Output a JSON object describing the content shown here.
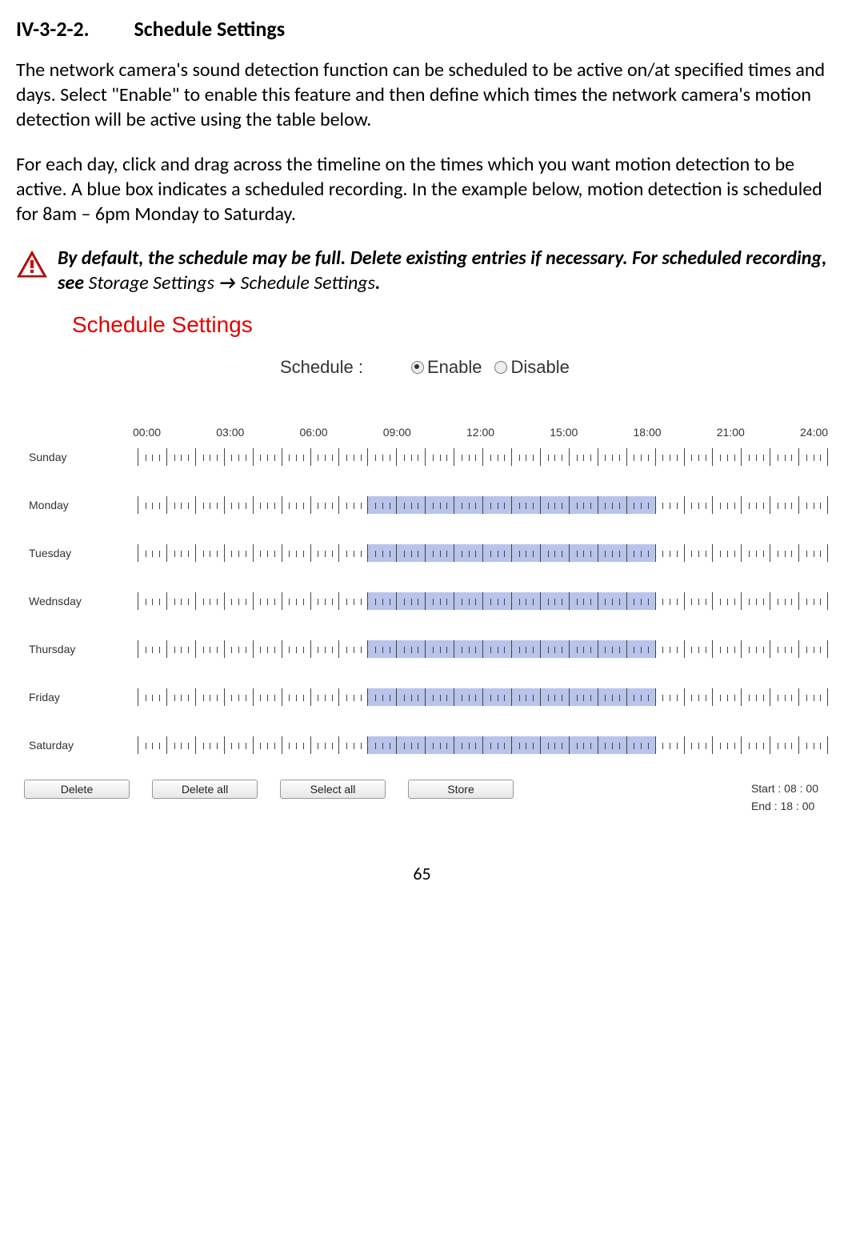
{
  "heading": {
    "number": "IV-3-2-2.",
    "title": "Schedule Settings"
  },
  "para1": "The network camera's sound detection function can be scheduled to be active on/at specified times and days. Select \"Enable\" to enable this feature and then define which times the network camera's motion detection will be active using the table below.",
  "para2": "For each day, click and drag across the timeline on the times which you want motion detection to be active. A blue box indicates a scheduled recording. In the example below, motion detection is scheduled for 8am – 6pm Monday to Saturday.",
  "note": {
    "bold1": "By default, the schedule may be full. Delete existing entries if necessary. For scheduled recording, see ",
    "plain1": "Storage Settings ",
    "arrow": "→ ",
    "plain2": "Schedule Settings",
    "bold2": "."
  },
  "panel": {
    "title": "Schedule Settings",
    "schedule_label": "Schedule :",
    "enable": "Enable",
    "disable": "Disable"
  },
  "time_labels": [
    "00:00",
    "03:00",
    "06:00",
    "09:00",
    "12:00",
    "15:00",
    "18:00",
    "21:00",
    "24:00"
  ],
  "days": [
    {
      "label": "Sunday",
      "sel": null
    },
    {
      "label": "Monday",
      "sel": [
        33.33,
        75
      ]
    },
    {
      "label": "Tuesday",
      "sel": [
        33.33,
        75
      ]
    },
    {
      "label": "Wednsday",
      "sel": [
        33.33,
        75
      ]
    },
    {
      "label": "Thursday",
      "sel": [
        33.33,
        75
      ]
    },
    {
      "label": "Friday",
      "sel": [
        33.33,
        75
      ]
    },
    {
      "label": "Saturday",
      "sel": [
        33.33,
        75
      ]
    }
  ],
  "buttons": {
    "delete": "Delete",
    "delete_all": "Delete all",
    "select_all": "Select all",
    "store": "Store"
  },
  "start_end": {
    "start": "Start : 08 : 00",
    "end": "End : 18 : 00"
  },
  "page_number": "65"
}
